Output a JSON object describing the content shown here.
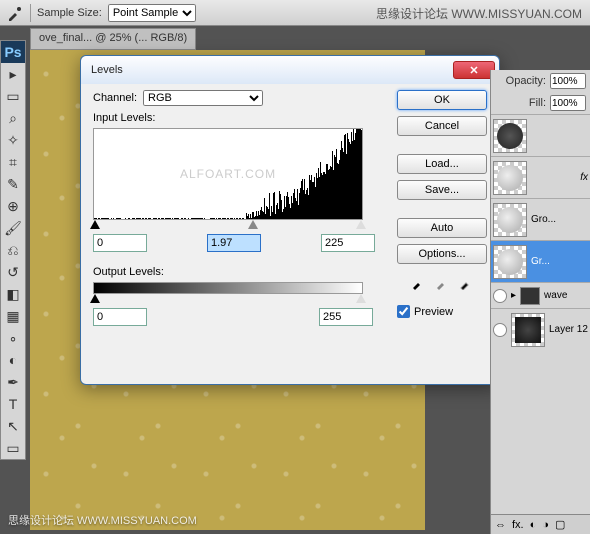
{
  "watermark_top": "思缘设计论坛 WWW.MISSYUAN.COM",
  "watermark_bottom": "思缘设计论坛 WWW.MISSYUAN.COM",
  "options_bar": {
    "sample_size_label": "Sample Size:",
    "sample_size_value": "Point Sample"
  },
  "document_tab": "ove_final... @ 25% (... RGB/8)",
  "dialog": {
    "title": "Levels",
    "channel_label": "Channel:",
    "channel_value": "RGB",
    "input_levels_label": "Input Levels:",
    "output_levels_label": "Output Levels:",
    "input": {
      "black": "0",
      "mid": "1.97",
      "white": "225"
    },
    "histogram_watermark": "ALFOART.COM",
    "output": {
      "black": "0",
      "white": "255"
    },
    "buttons": {
      "ok": "OK",
      "cancel": "Cancel",
      "load": "Load...",
      "save": "Save...",
      "auto": "Auto",
      "options": "Options..."
    },
    "preview_label": "Preview",
    "preview_checked": true
  },
  "layers_panel": {
    "opacity_label": "Opacity:",
    "opacity_value": "100%",
    "fill_label": "Fill:",
    "fill_value": "100%",
    "items": [
      {
        "name": ""
      },
      {
        "name": ""
      },
      {
        "name": "Gro..."
      },
      {
        "name": "Gr...",
        "selected": true
      },
      {
        "name": "wave"
      },
      {
        "name": "Layer 12"
      }
    ],
    "bottom_fx": "fx."
  }
}
